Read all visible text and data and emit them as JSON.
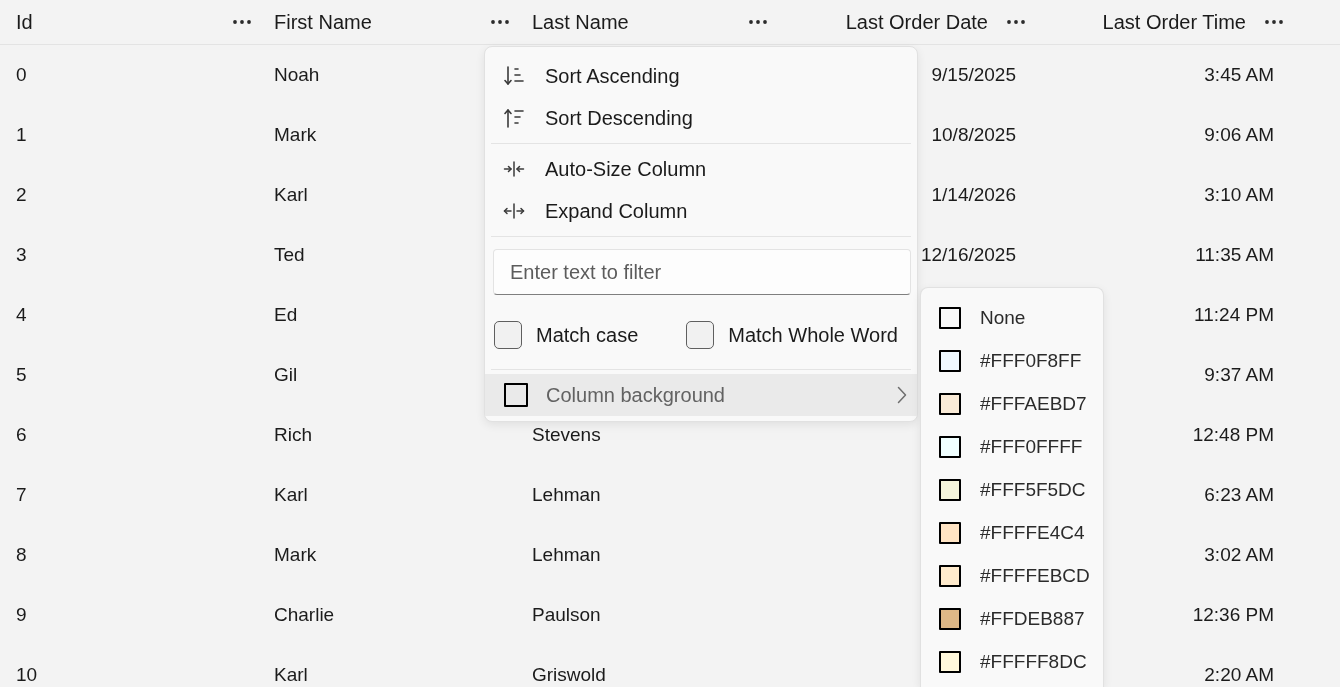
{
  "table": {
    "columns": [
      {
        "label": "Id",
        "kind": "text"
      },
      {
        "label": "First Name",
        "kind": "text"
      },
      {
        "label": "Last Name",
        "kind": "text"
      },
      {
        "label": "Last Order Date",
        "kind": "date"
      },
      {
        "label": "Last Order Time",
        "kind": "time"
      }
    ],
    "rows": [
      [
        "0",
        "Noah",
        null,
        "9/15/2025",
        "3:45 AM"
      ],
      [
        "1",
        "Mark",
        null,
        "10/8/2025",
        "9:06 AM"
      ],
      [
        "2",
        "Karl",
        null,
        "1/14/2026",
        "3:10 AM"
      ],
      [
        "3",
        "Ted",
        null,
        "12/16/2025",
        "11:35 AM"
      ],
      [
        "4",
        "Ed",
        null,
        null,
        "11:24 PM"
      ],
      [
        "5",
        "Gil",
        null,
        null,
        "9:37 AM"
      ],
      [
        "6",
        "Rich",
        "Stevens",
        null,
        "12:48 PM"
      ],
      [
        "7",
        "Karl",
        "Lehman",
        null,
        "6:23 AM"
      ],
      [
        "8",
        "Mark",
        "Lehman",
        null,
        "3:02 AM"
      ],
      [
        "9",
        "Charlie",
        "Paulson",
        null,
        "12:36 PM"
      ],
      [
        "10",
        "Karl",
        "Griswold",
        null,
        "2:20 AM"
      ]
    ]
  },
  "column_menu": {
    "sort_ascending": {
      "label": "Sort Ascending"
    },
    "sort_descending": {
      "label": "Sort Descending"
    },
    "auto_size_column": {
      "label": "Auto-Size Column"
    },
    "expand_column": {
      "label": "Expand Column"
    },
    "filter": {
      "placeholder": "Enter text to filter"
    },
    "options": [
      {
        "label": "Match case",
        "checked": false
      },
      {
        "label": "Match Whole Word",
        "checked": false
      }
    ],
    "column_background": {
      "label": "Column background",
      "expanded": true
    }
  },
  "color_submenu": {
    "items": [
      {
        "label": "None"
      },
      {
        "label": "#FFF0F8FF",
        "color": "#f0f8ff"
      },
      {
        "label": "#FFFAEBD7",
        "color": "#faebd7"
      },
      {
        "label": "#FFF0FFFF",
        "color": "#f0ffff"
      },
      {
        "label": "#FFF5F5DC",
        "color": "#f5f5dc"
      },
      {
        "label": "#FFFFE4C4",
        "color": "#ffe4c4"
      },
      {
        "label": "#FFFFEBCD",
        "color": "#ffebcd"
      },
      {
        "label": "#FFDEB887",
        "color": "#deb887"
      },
      {
        "label": "#FFFFF8DC",
        "color": "#fff8dc"
      }
    ]
  }
}
